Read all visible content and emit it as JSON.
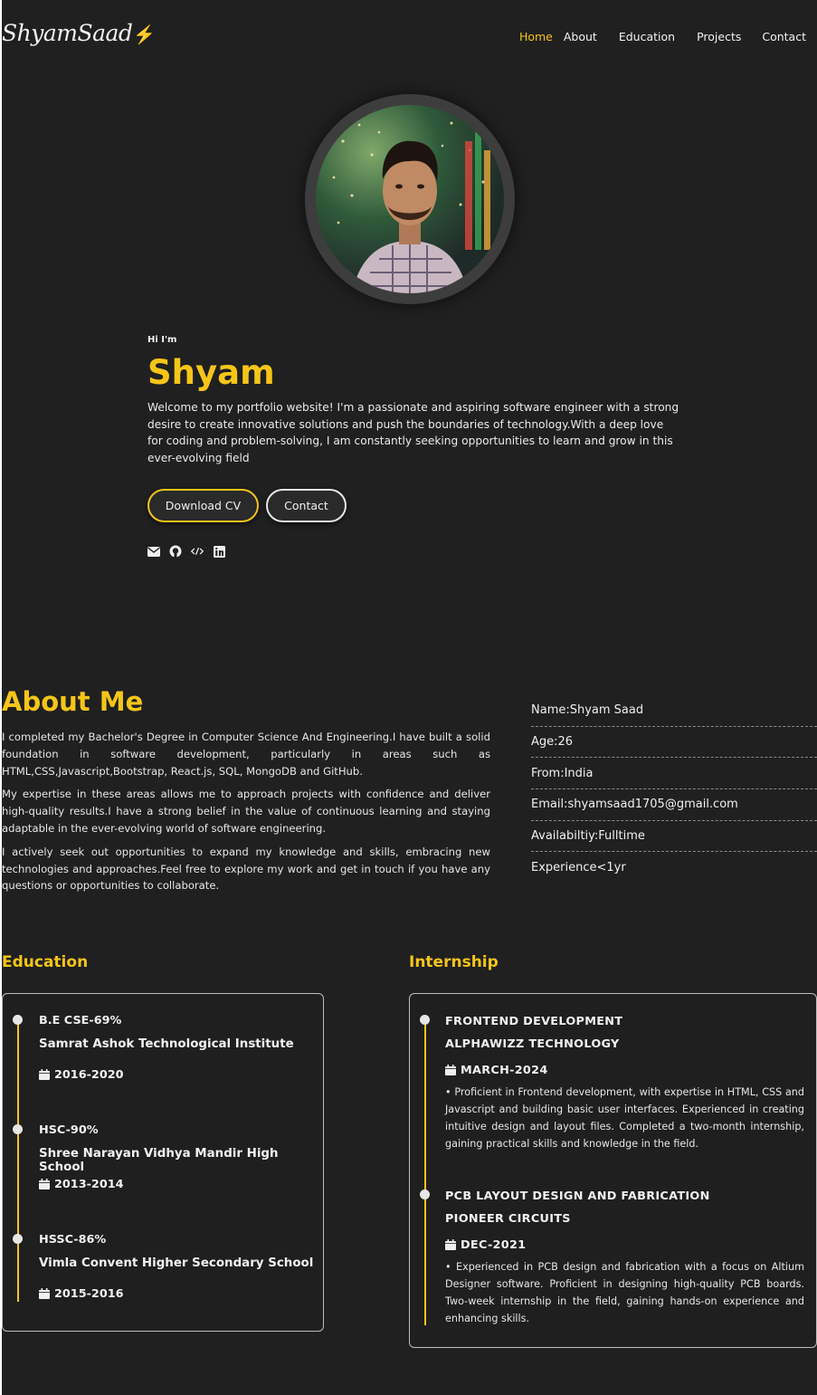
{
  "nav": {
    "logo_text": "ShyamSaad",
    "logo_icon": "bolt-icon",
    "items": [
      {
        "label": "Home",
        "active": true
      },
      {
        "label": "About",
        "active": false
      },
      {
        "label": "Education",
        "active": false
      },
      {
        "label": "Projects",
        "active": false
      },
      {
        "label": "Contact",
        "active": false
      }
    ]
  },
  "hero": {
    "greeting": "Hi I'm",
    "name": "Shyam",
    "intro": "Welcome to my portfolio website! I'm a passionate and aspiring software engineer with a strong desire to create innovative solutions and push the boundaries of technology.With a deep love for coding and problem-solving, I am constantly seeking opportunities to learn and grow in this ever-evolving field",
    "download_label": "Download CV",
    "contact_label": "Contact",
    "socials": [
      "envelope-icon",
      "github-icon",
      "code-icon",
      "linkedin-icon"
    ]
  },
  "about": {
    "title": "About Me",
    "paragraphs": [
      "I completed my Bachelor's Degree in Computer Science And Engineering.I have built a solid foundation in software development, particularly in areas such as HTML,CSS,Javascript,Bootstrap, React.js, SQL, MongoDB and GitHub.",
      "My expertise in these areas allows me to approach projects with confidence and deliver high-quality results.I have a strong belief in the value of continuous learning and staying adaptable in the ever-evolving world of software engineering.",
      "I actively seek out opportunities to expand my knowledge and skills, embracing new technologies and approaches.Feel free to explore my work and get in touch if you have any questions or opportunities to collaborate."
    ],
    "info": [
      "Name:Shyam Saad",
      "Age:26",
      "From:India",
      "Email:shyamsaad1705@gmail.com",
      "Availabiltiy:Fulltime",
      "Experience<1yr"
    ]
  },
  "education": {
    "title": "Education",
    "items": [
      {
        "degree": "B.E CSE-69%",
        "school": "Samrat Ashok Technological Institute",
        "years": "2016-2020"
      },
      {
        "degree": "HSC-90%",
        "school": "Shree Narayan Vidhya Mandir High School",
        "years": "2013-2014"
      },
      {
        "degree": "HSSC-86%",
        "school": "Vimla Convent Higher Secondary School",
        "years": "2015-2016"
      }
    ]
  },
  "internship": {
    "title": "Internship",
    "items": [
      {
        "role": "FRONTEND DEVELOPMENT",
        "company": "ALPHAWIZZ TECHNOLOGY",
        "date": "MARCH-2024",
        "desc": "• Proficient in Frontend development, with expertise in HTML, CSS and Javascript and building basic user interfaces. Experienced in creating intuitive design and layout files. Completed a two-month internship, gaining practical skills and knowledge in the field."
      },
      {
        "role": "PCB LAYOUT DESIGN AND FABRICATION",
        "company": "PIONEER CIRCUITS",
        "date": "DEC-2021",
        "desc": "• Experienced in PCB design and fabrication with a focus on Altium Designer software. Proficient in designing high-quality PCB boards. Two-week internship in the field, gaining hands-on experience and enhancing skills."
      }
    ]
  },
  "colors": {
    "accent": "#f5c518",
    "background": "#202020",
    "text": "#f0f0f0"
  }
}
